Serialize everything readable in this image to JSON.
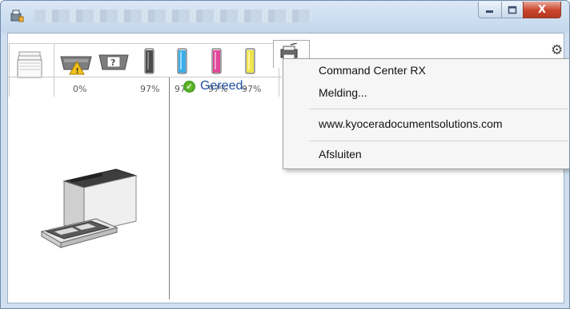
{
  "toolbar": {
    "toner_black": "0%",
    "levels": [
      "97%",
      "97%",
      "97%",
      "97%"
    ],
    "level_colors": [
      "#4b4b4b",
      "#3aaee8",
      "#e0479a",
      "#f0e54a"
    ]
  },
  "status": {
    "text": "Gereed."
  },
  "context_menu": {
    "items": [
      "Command Center RX",
      "Melding...",
      "www.kyoceradocumentsolutions.com",
      "Afsluiten"
    ]
  },
  "window_controls": {
    "close_glyph": "X"
  }
}
